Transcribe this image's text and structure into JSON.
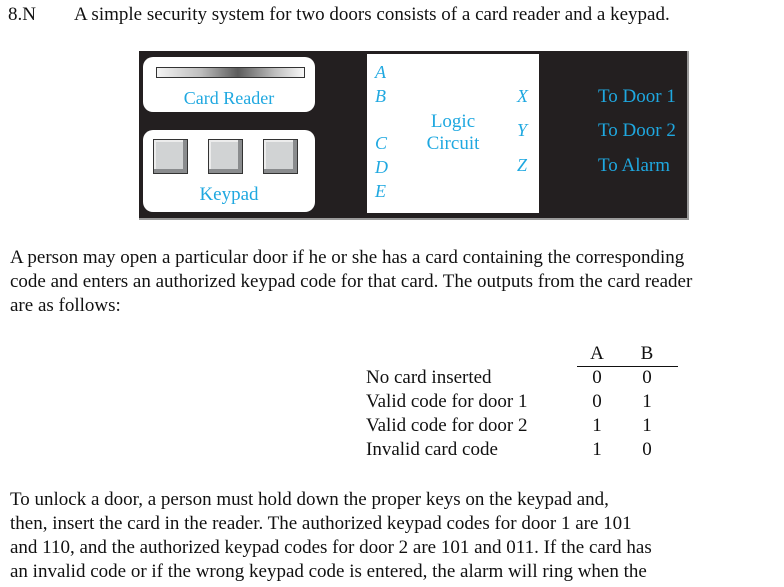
{
  "problem": {
    "number": "8.N",
    "intro": "A simple security system for two doors consists of a card reader and a keypad."
  },
  "diagram": {
    "card_reader_label": "Card Reader",
    "keypad_label": "Keypad",
    "keypad_key_count": 3,
    "logic_label_line1": "Logic",
    "logic_label_line2": "Circuit",
    "inputs": [
      "A",
      "B",
      "C",
      "D",
      "E"
    ],
    "outputs": [
      "X",
      "Y",
      "Z"
    ],
    "destinations": [
      "To Door 1",
      "To Door 2",
      "To Alarm"
    ],
    "colors": {
      "panel": "#231f20",
      "label": "#1fa8e0"
    }
  },
  "paragraph1": [
    "A person may open a particular door if he or she has a card containing the corresponding",
    "code and enters an authorized keypad code for that card. The outputs from the card reader",
    "are as follows:"
  ],
  "card_table": {
    "headers": [
      "A",
      "B"
    ],
    "rows": [
      {
        "label": "No card inserted",
        "a": "0",
        "b": "0"
      },
      {
        "label": "Valid code for door 1",
        "a": "0",
        "b": "1"
      },
      {
        "label": "Valid code for door 2",
        "a": "1",
        "b": "1"
      },
      {
        "label": "Invalid card code",
        "a": "1",
        "b": "0"
      }
    ]
  },
  "paragraph2": [
    "To unlock a door, a person must hold down the proper keys on the keypad and,",
    "then, insert the card in the reader. The authorized keypad codes for door 1 are 101",
    "and 110, and the authorized keypad codes for door 2 are 101 and 011. If the card has",
    "an invalid code or if the wrong keypad code is entered, the alarm will ring when the"
  ]
}
